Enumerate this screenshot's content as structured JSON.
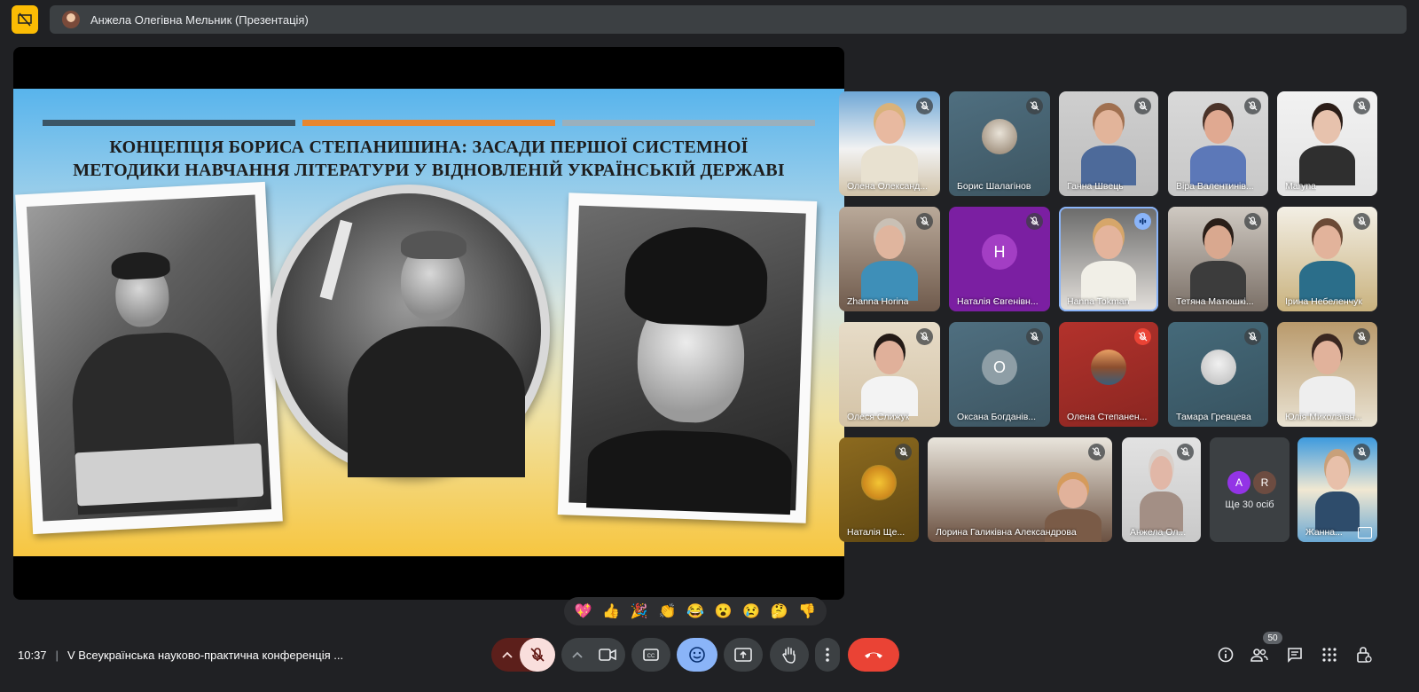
{
  "presentation": {
    "title": "Анжела Олегівна Мельник (Презентація)"
  },
  "slide": {
    "title": "КОНЦЕПЦІЯ БОРИСА СТЕПАНИШИНА: ЗАСАДИ ПЕРШОЇ СИСТЕМНОЇ\nМЕТОДИКИ НАВЧАННЯ ЛІТЕРАТУРИ У ВІДНОВЛЕНІЙ УКРАЇНСЬКІЙ ДЕРЖАВІ",
    "bar_colors": [
      "#3b5566",
      "#e8862e",
      "#9ab0bd"
    ]
  },
  "participants": [
    {
      "name": "Олена Олександ...",
      "mic": "muted"
    },
    {
      "name": "Борис Шалагінов",
      "mic": "muted"
    },
    {
      "name": "Ганна Швець",
      "mic": "muted"
    },
    {
      "name": "Віра Валентинів...",
      "mic": "muted"
    },
    {
      "name": "Marуna",
      "mic": "muted"
    },
    {
      "name": "Zhanna Horina",
      "mic": "muted"
    },
    {
      "name": "Наталія Євгенівн...",
      "mic": "muted",
      "initial": "H"
    },
    {
      "name": "Hanna Tokman",
      "mic": "speaking"
    },
    {
      "name": "Тетяна Матюшкі...",
      "mic": "muted"
    },
    {
      "name": "Ірина Небеленчук",
      "mic": "muted"
    },
    {
      "name": "Олеся Слижук",
      "mic": "muted"
    },
    {
      "name": "Оксана Богданів...",
      "mic": "muted",
      "initial": "O"
    },
    {
      "name": "Олена Степанен...",
      "mic": "muted"
    },
    {
      "name": "Тамара Гревцева",
      "mic": "muted"
    },
    {
      "name": "Юлія Миколаївн...",
      "mic": "muted"
    },
    {
      "name": "Наталія Ще...",
      "mic": "muted"
    },
    {
      "name": "Лорина Галиківна Александрова",
      "mic": "muted"
    },
    {
      "name": "Анжела Ол...",
      "mic": "muted"
    },
    {
      "name": "Жанна...",
      "mic": "muted"
    }
  ],
  "more": {
    "avatars": [
      "A",
      "R"
    ],
    "label": "Ще 30 осіб"
  },
  "reactions": [
    "💖",
    "👍",
    "🎉",
    "👏",
    "😂",
    "😮",
    "😢",
    "🤔",
    "👎"
  ],
  "meeting": {
    "time": "10:37",
    "separator": "|",
    "title": "V Всеукраїнська науково-практична конференція ..."
  },
  "people_count": "50",
  "colors": {
    "bg": "#202124",
    "end_call": "#ea4335",
    "mic_off": "#f9dedc",
    "reactions_active": "#8ab4f8",
    "present_icon": "#fbbc04"
  }
}
